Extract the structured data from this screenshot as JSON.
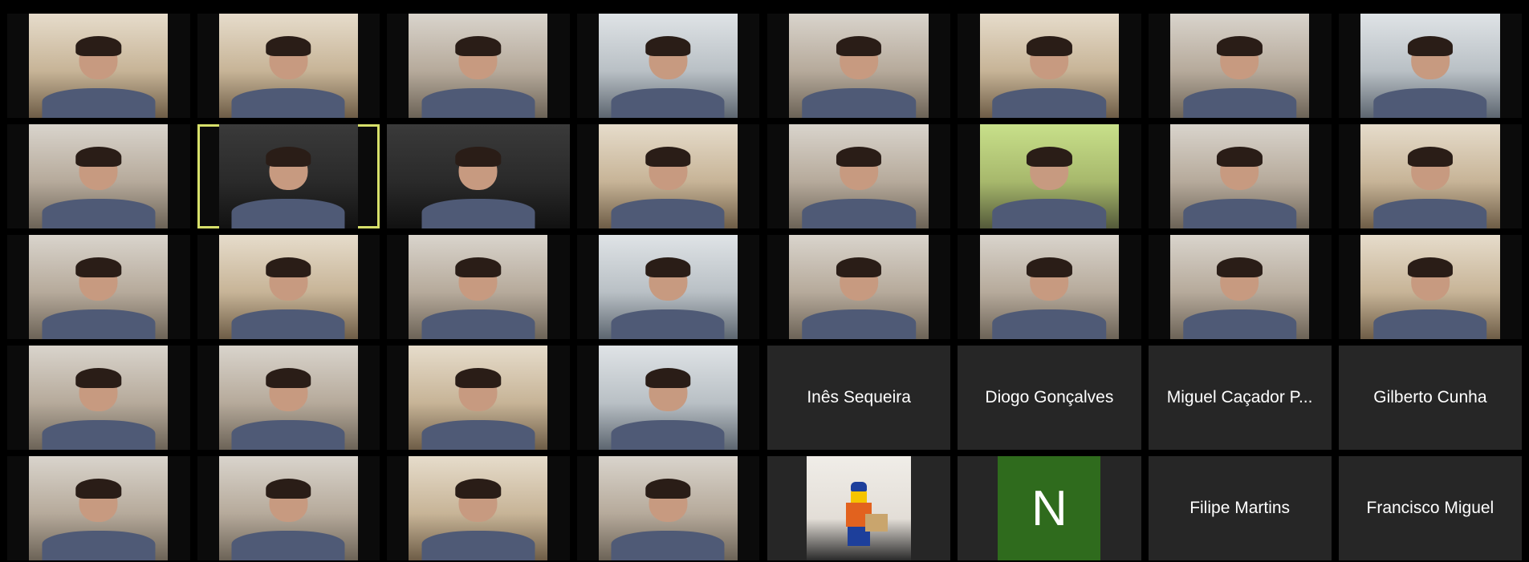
{
  "window": {
    "title": ""
  },
  "colors": {
    "background": "#000000",
    "tile_background": "#262626",
    "active_speaker_border": "#d7e06a",
    "initial_box": "#2f6b1d",
    "name_text": "#ffffff"
  },
  "left_panel": {
    "tiles": [
      {
        "type": "video",
        "label": "participant-video"
      },
      {
        "type": "video",
        "label": "participant-video"
      },
      {
        "type": "video",
        "label": "participant-video"
      },
      {
        "type": "video",
        "label": "participant-video"
      },
      {
        "type": "video",
        "label": "participant-video"
      },
      {
        "type": "video",
        "label": "participant-video",
        "active_speaker": true
      },
      {
        "type": "video",
        "label": "participant-video"
      },
      {
        "type": "video",
        "label": "participant-video"
      },
      {
        "type": "video",
        "label": "participant-video"
      },
      {
        "type": "video",
        "label": "participant-video"
      },
      {
        "type": "video",
        "label": "participant-video"
      },
      {
        "type": "video",
        "label": "participant-video"
      },
      {
        "type": "video",
        "label": "participant-video"
      },
      {
        "type": "video",
        "label": "participant-video"
      },
      {
        "type": "video",
        "label": "participant-video"
      },
      {
        "type": "video",
        "label": "participant-video"
      },
      {
        "type": "video",
        "label": "participant-video"
      },
      {
        "type": "video",
        "label": "participant-video"
      },
      {
        "type": "video",
        "label": "participant-video"
      },
      {
        "type": "video",
        "label": "participant-video"
      }
    ]
  },
  "right_panel": {
    "tiles": [
      {
        "type": "video",
        "label": "participant-video"
      },
      {
        "type": "video",
        "label": "participant-video"
      },
      {
        "type": "video",
        "label": "participant-video"
      },
      {
        "type": "video",
        "label": "participant-video"
      },
      {
        "type": "video",
        "label": "participant-video"
      },
      {
        "type": "video",
        "label": "participant-video"
      },
      {
        "type": "video",
        "label": "participant-video"
      },
      {
        "type": "video",
        "label": "participant-video"
      },
      {
        "type": "video",
        "label": "participant-video"
      },
      {
        "type": "video",
        "label": "participant-video"
      },
      {
        "type": "video",
        "label": "participant-video"
      },
      {
        "type": "video",
        "label": "participant-video"
      },
      {
        "type": "name",
        "name": "Inês Sequeira"
      },
      {
        "type": "name",
        "name": "Diogo Gonçalves"
      },
      {
        "type": "name",
        "name": "Miguel Caçador P..."
      },
      {
        "type": "name",
        "name": "Gilberto Cunha"
      },
      {
        "type": "photo",
        "label": "lego-avatar"
      },
      {
        "type": "initial",
        "initial": "N"
      },
      {
        "type": "name",
        "name": "Filipe Martins"
      },
      {
        "type": "name",
        "name": "Francisco Miguel"
      }
    ]
  }
}
